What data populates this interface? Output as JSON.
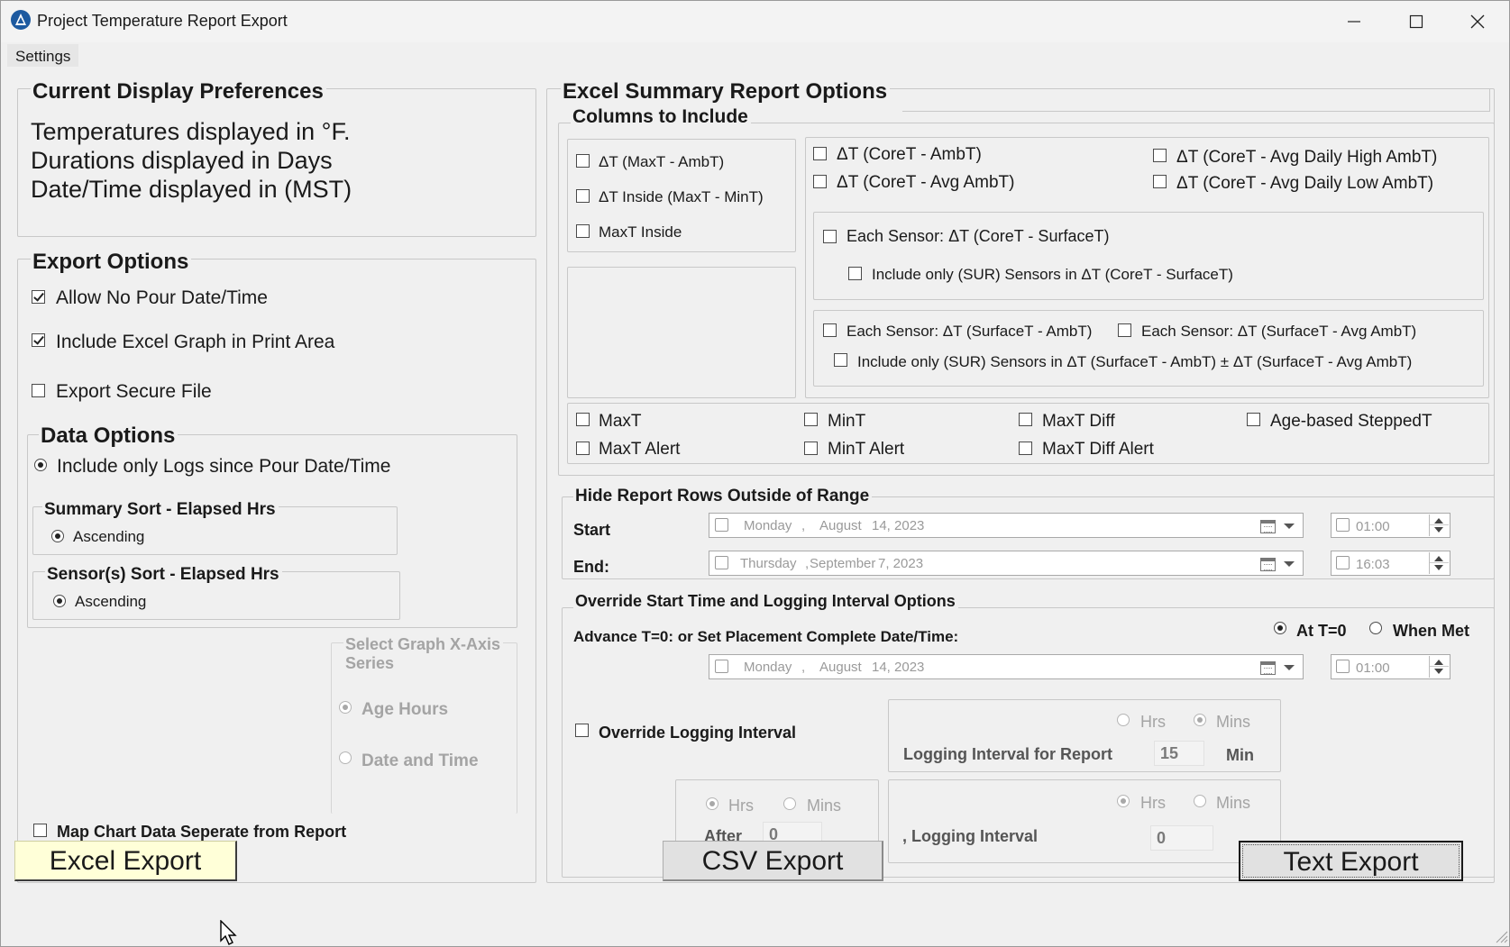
{
  "window": {
    "title": "Project Temperature Report Export",
    "minimize_label": "—",
    "maximize_label": "▢",
    "close_label": "✕"
  },
  "menu": {
    "settings": "Settings"
  },
  "display_prefs": {
    "title": "Current Display Preferences",
    "line1": "Temperatures displayed in °F.",
    "line2": "Durations displayed in Days",
    "line3": "Date/Time displayed in (MST)"
  },
  "export_options": {
    "title": "Export Options",
    "allow_no_pour": {
      "label": "Allow No Pour Date/Time",
      "checked": true
    },
    "include_graph": {
      "label": "Include Excel Graph in Print Area",
      "checked": true
    },
    "secure_file": {
      "label": "Export Secure File",
      "checked": false
    }
  },
  "data_options": {
    "title": "Data Options",
    "include_logs": "Include only Logs since Pour Date/Time",
    "summary_sort_title": "Summary Sort - Elapsed Hrs",
    "summary_sort_value": "Ascending",
    "sensor_sort_title": "Sensor(s) Sort - Elapsed Hrs",
    "sensor_sort_value": "Ascending"
  },
  "x_axis": {
    "title_line1": "Select Graph X-Axis",
    "title_line2": "Series",
    "age_hours": "Age Hours",
    "date_time": "Date and Time"
  },
  "map_chart": {
    "label": "Map Chart Data Seperate from Report",
    "checked": false
  },
  "excel_summary": {
    "title": "Excel Summary Report Options",
    "columns_title": "Columns to Include",
    "col_a": [
      "ΔT (MaxT - AmbT)",
      "ΔT Inside (MaxT - MinT)",
      "MaxT Inside"
    ],
    "core_amb": "ΔT (CoreT - AmbT)",
    "core_avg_amb": "ΔT (CoreT - Avg AmbT)",
    "core_high": "ΔT (CoreT - Avg Daily High AmbT)",
    "core_low": "ΔT (CoreT - Avg Daily Low AmbT)",
    "each_core_surface": "Each Sensor: ΔT (CoreT - SurfaceT)",
    "sur_core_surface": "Include only (SUR) Sensors in ΔT (CoreT - SurfaceT)",
    "each_surface_amb": "Each Sensor: ΔT (SurfaceT - AmbT)",
    "each_surface_avg": "Each Sensor: ΔT (SurfaceT - Avg AmbT)",
    "sur_surface_both": "Include only (SUR) Sensors in ΔT (SurfaceT - AmbT) ± ΔT (SurfaceT - Avg AmbT)",
    "maxt": "MaxT",
    "maxt_alert": "MaxT Alert",
    "mint": "MinT",
    "mint_alert": "MinT Alert",
    "maxt_diff": "MaxT Diff",
    "maxt_diff_alert": "MaxT Diff Alert",
    "age_stepped": "Age-based SteppedT"
  },
  "hide_rows": {
    "title": "Hide Report Rows Outside of Range",
    "start_label": "Start",
    "end_label": "End:",
    "start_day": "Monday",
    "start_comma": ",",
    "start_month": "August",
    "start_date": "14, 2023",
    "start_time": "01:00",
    "end_day": "Thursday",
    "end_comma": ",",
    "end_month": "September",
    "end_date": "7, 2023",
    "end_time": "16:03"
  },
  "override": {
    "title": "Override Start Time and Logging Interval Options",
    "advance_label": "Advance T=0: or Set Placement Complete Date/Time:",
    "at_t0": "At T=0",
    "when_met": "When Met",
    "adv_day": "Monday",
    "adv_comma": ",",
    "adv_month": "August",
    "adv_date": "14, 2023",
    "adv_time": "01:00",
    "override_logging": "Override Logging Interval",
    "hrs": "Hrs",
    "mins": "Mins",
    "logging_for_report": "Logging Interval for Report",
    "logging_value": "15",
    "min_unit": "Min",
    "after_label": "After",
    "after_value": "0",
    "logging_interval": ", Logging Interval",
    "logging_interval_value": "0"
  },
  "buttons": {
    "excel": "Excel Export",
    "csv": "CSV Export",
    "text": "Text Export"
  },
  "colors": {
    "accent": "#ffffd8",
    "background": "#f0f0f0",
    "disabled_text": "#a4a4a4"
  }
}
